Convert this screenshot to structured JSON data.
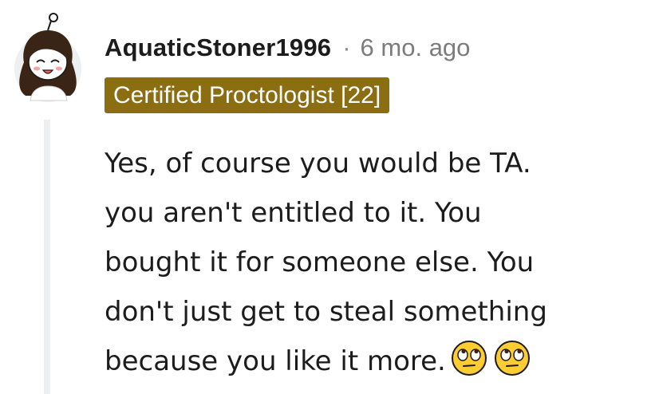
{
  "comment": {
    "username": "AquaticStoner1996",
    "separator": "·",
    "timestamp": "6 mo. ago",
    "flair": "Certified Proctologist [22]",
    "body_lines": [
      "Yes, of course you would be TA.",
      "you aren't entitled to it. You",
      "bought it for someone else. You",
      "don't just get to steal something",
      "because you like it more."
    ],
    "emojis": [
      "eye-roll-emoji",
      "eye-roll-emoji"
    ]
  },
  "colors": {
    "flair_background": "#8c6e12",
    "flair_text": "#ffffff",
    "username": "#1c1c1c",
    "timestamp": "#7c7c7c",
    "thread_line": "#edeff1"
  }
}
